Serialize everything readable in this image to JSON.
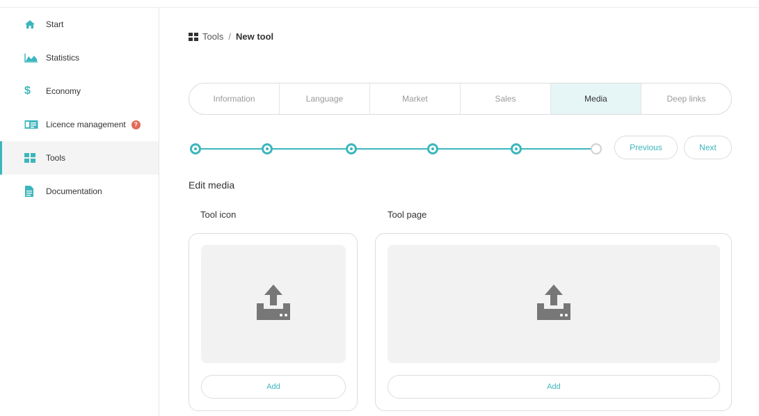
{
  "sidebar": {
    "items": [
      {
        "label": "Start",
        "icon": "home-icon"
      },
      {
        "label": "Statistics",
        "icon": "area-chart-icon"
      },
      {
        "label": "Economy",
        "icon": "dollar-icon"
      },
      {
        "label": "Licence management",
        "icon": "id-card-icon",
        "badge": "?"
      },
      {
        "label": "Tools",
        "icon": "grid-icon",
        "active": true
      },
      {
        "label": "Documentation",
        "icon": "document-icon"
      }
    ]
  },
  "breadcrumb": {
    "icon": "grid-icon",
    "parent": "Tools",
    "separator": "/",
    "current": "New tool"
  },
  "tabs": [
    "Information",
    "Language",
    "Market",
    "Sales",
    "Media",
    "Deep links"
  ],
  "active_tab": "Media",
  "stepper": {
    "completed_steps": 5,
    "total_steps": 6
  },
  "nav_buttons": {
    "previous": "Previous",
    "next": "Next"
  },
  "section_title": "Edit media",
  "media": {
    "tool_icon": {
      "label": "Tool icon",
      "add_label": "Add",
      "icon": "upload-icon"
    },
    "tool_page": {
      "label": "Tool page",
      "add_label": "Add",
      "icon": "upload-icon"
    }
  },
  "colors": {
    "accent": "#3cb6bd",
    "badge": "#e06a55",
    "active_tab_bg": "#e6f5f6"
  }
}
